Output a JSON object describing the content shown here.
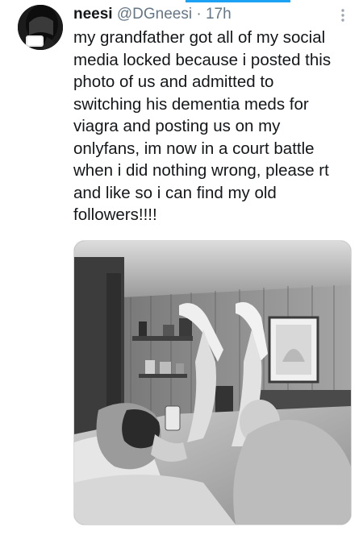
{
  "tweet": {
    "display_name": "neesi",
    "handle": "@DGneesi",
    "separator": "·",
    "time": "17h",
    "text": "my grandfather got all of my social\nmedia locked because i posted this\nphoto of us and admitted to\nswitching his dementia meds for\nviagra and posting us on my\nonlyfans, im now in a court battle\nwhen i did nothing wrong, please rt\nand like so i can find my old\nfollowers!!!!",
    "media": {
      "description": "photo",
      "style": "grayscale"
    }
  },
  "icons": {
    "more": "more-vertical-icon",
    "avatar": "avatar"
  },
  "colors": {
    "accent": "#1da1f2",
    "secondary_text": "#657786"
  }
}
